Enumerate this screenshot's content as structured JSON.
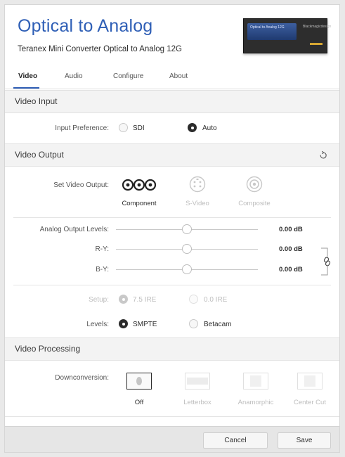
{
  "header": {
    "title": "Optical to Analog",
    "subtitle": "Teranex Mini Converter Optical to Analog 12G",
    "device_screen_text": "Optical to Analog 12G",
    "device_brand_text": "Blackmagicdesign"
  },
  "tabs": [
    {
      "label": "Video",
      "active": true
    },
    {
      "label": "Audio",
      "active": false
    },
    {
      "label": "Configure",
      "active": false
    },
    {
      "label": "About",
      "active": false
    }
  ],
  "video_input": {
    "heading": "Video Input",
    "preference_label": "Input Preference:",
    "options": [
      {
        "label": "SDI",
        "selected": false
      },
      {
        "label": "Auto",
        "selected": true
      }
    ]
  },
  "video_output": {
    "heading": "Video Output",
    "reset_icon": "reset-icon",
    "set_label": "Set Video Output:",
    "outputs": [
      {
        "label": "Component",
        "selected": true
      },
      {
        "label": "S-Video",
        "selected": false
      },
      {
        "label": "Composite",
        "selected": false
      }
    ],
    "levels": [
      {
        "label": "Analog Output Levels:",
        "value": "0.00 dB",
        "position": 0.5
      },
      {
        "label": "R-Y:",
        "value": "0.00 dB",
        "position": 0.5
      },
      {
        "label": "B-Y:",
        "value": "0.00 dB",
        "position": 0.5
      }
    ],
    "link_icon": "link-icon",
    "setup": {
      "label": "Setup:",
      "options": [
        {
          "label": "7.5 IRE",
          "selected": true
        },
        {
          "label": "0.0 IRE",
          "selected": false
        }
      ]
    },
    "levels_select": {
      "label": "Levels:",
      "options": [
        {
          "label": "SMPTE",
          "selected": true
        },
        {
          "label": "Betacam",
          "selected": false
        }
      ]
    }
  },
  "video_processing": {
    "heading": "Video Processing",
    "downconversion_label": "Downconversion:",
    "options": [
      {
        "label": "Off",
        "selected": true
      },
      {
        "label": "Letterbox",
        "selected": false
      },
      {
        "label": "Anamorphic",
        "selected": false
      },
      {
        "label": "Center Cut",
        "selected": false
      }
    ]
  },
  "footer": {
    "cancel_label": "Cancel",
    "save_label": "Save"
  },
  "colors": {
    "accent": "#2f5fb6",
    "section_bg": "#f3f3f3",
    "disabled_text": "#bdbdbd"
  }
}
